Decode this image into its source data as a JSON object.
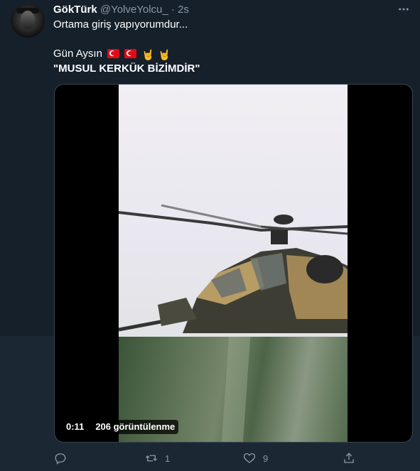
{
  "tweet": {
    "author_name": "GökTürk",
    "author_handle": "@YolveYolcu_",
    "separator": "·",
    "timestamp": "2s",
    "more_icon": "more-options-icon",
    "line1": "Ortama giriş yapıyorumdur...",
    "line2": "Gün Aysın",
    "line2_emojis": [
      "turkish-flag",
      "turkish-flag",
      "sign-of-horns",
      "sign-of-horns"
    ],
    "line3": "\"MUSUL KERKÜK BİZİMDİR\""
  },
  "media": {
    "type": "video",
    "duration": "0:11",
    "views": "206 görüntülenme"
  },
  "actions": {
    "reply": {
      "icon": "reply-icon",
      "count": ""
    },
    "retweet": {
      "icon": "retweet-icon",
      "count": "1"
    },
    "like": {
      "icon": "heart-icon",
      "count": "9"
    },
    "share": {
      "icon": "share-icon",
      "count": ""
    }
  },
  "colors": {
    "background": "#15202b",
    "secondary_text": "#8899a6",
    "primary_text": "#ffffff",
    "border": "#38444d"
  }
}
